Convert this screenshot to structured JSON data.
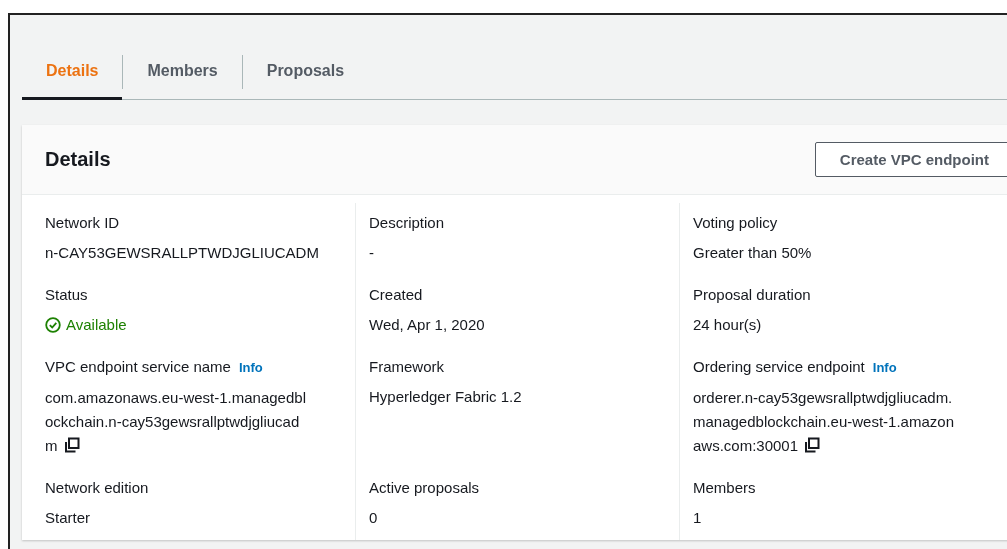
{
  "tabs": [
    {
      "label": "Details",
      "selected": true
    },
    {
      "label": "Members",
      "selected": false
    },
    {
      "label": "Proposals",
      "selected": false
    }
  ],
  "card": {
    "title": "Details",
    "button": "Create VPC endpoint",
    "columns": [
      {
        "fields": [
          {
            "label": "Network ID",
            "value": "n-CAY53GEWSRALLPTWDJGLIUCADM",
            "kind": "text"
          },
          {
            "label": "Status",
            "value": "Available",
            "kind": "status"
          },
          {
            "label": "VPC endpoint service name",
            "info": "Info",
            "lines": [
              "com.amazonaws.eu-west-1.managedbl",
              "ockchain.n-cay53gewsrallptwdjgliucad",
              "m"
            ],
            "kind": "copyable"
          },
          {
            "label": "Network edition",
            "value": "Starter",
            "kind": "text"
          }
        ]
      },
      {
        "fields": [
          {
            "label": "Description",
            "value": "-",
            "kind": "text"
          },
          {
            "label": "Created",
            "value": "Wed, Apr 1, 2020",
            "kind": "text"
          },
          {
            "label": "Framework",
            "value": "Hyperledger Fabric 1.2",
            "kind": "text"
          },
          {
            "label": "Active proposals",
            "value": "0",
            "kind": "text"
          }
        ]
      },
      {
        "fields": [
          {
            "label": "Voting policy",
            "value": "Greater than 50%",
            "kind": "text"
          },
          {
            "label": "Proposal duration",
            "value": "24 hour(s)",
            "kind": "text"
          },
          {
            "label": "Ordering service endpoint",
            "info": "Info",
            "lines": [
              "orderer.n-cay53gewsrallptwdjgliucadm.",
              "managedblockchain.eu-west-1.amazon",
              "aws.com:30001"
            ],
            "kind": "copyable"
          },
          {
            "label": "Members",
            "value": "1",
            "kind": "text"
          }
        ]
      }
    ]
  }
}
